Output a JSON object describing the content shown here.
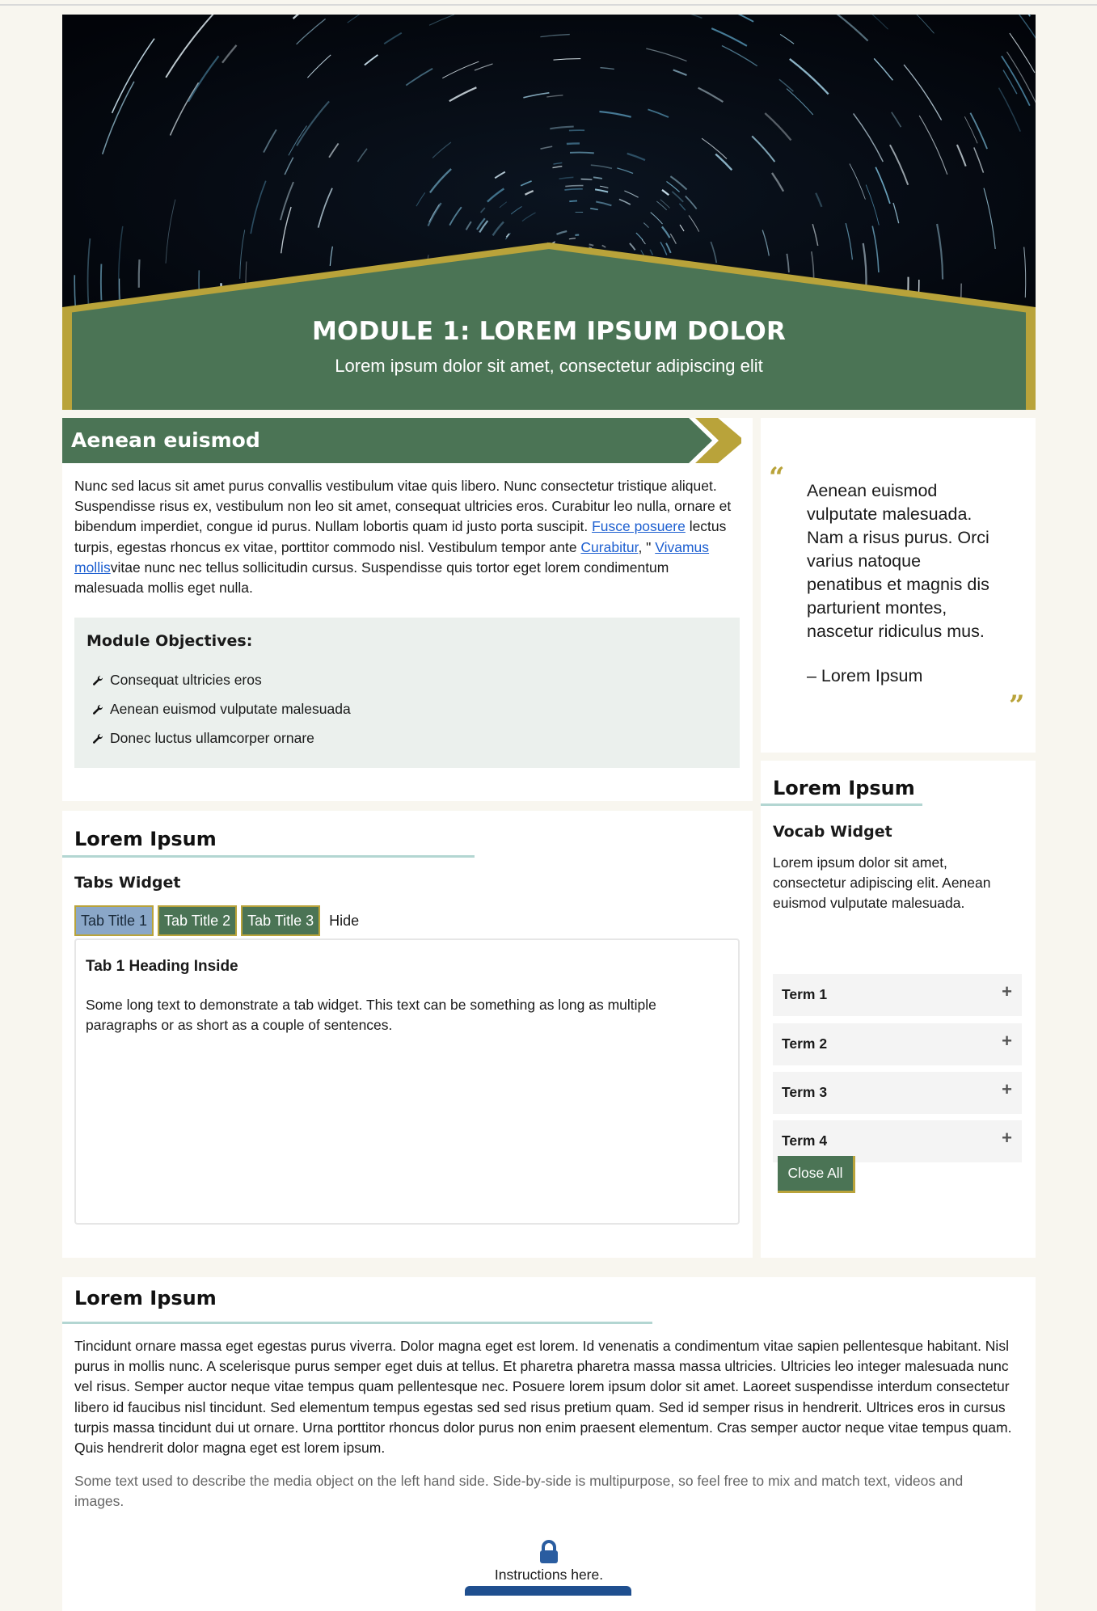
{
  "colors": {
    "green": "#4b7455",
    "gold": "#b9a33a",
    "teal_rule": "#b3d6d2",
    "link": "#1d5fd0",
    "panel_bg": "#ebf0ed"
  },
  "hero": {
    "title": "MODULE 1: LOREM IPSUM DOLOR",
    "subtitle": "Lorem ipsum dolor sit amet, consectetur adipiscing elit"
  },
  "intro_section": {
    "banner": "Aenean euismod",
    "p1": "Nunc sed lacus sit amet purus convallis vestibulum vitae quis libero. Nunc consectetur tristique aliquet. Suspendisse risus ex, vestibulum non leo sit amet, consequat ultricies eros. Curabitur leo nulla, ornare et bibendum imperdiet, congue id purus. Nullam lobortis quam id justo porta suscipit. ",
    "link1": "Fusce posuere",
    "p2": " lectus turpis, egestas rhoncus ex vitae, porttitor commodo nisl. Vestibulum tempor ante ",
    "link2": "Curabitur",
    "p3": ", \" ",
    "link3": "Vivamus mollis",
    "p4": "vitae nunc nec tellus sollicitudin cursus. Suspendisse quis tortor eget lorem condimentum malesuada mollis eget nulla.",
    "objectives_title": "Module Objectives:",
    "objectives": [
      "Consequat ultricies eros",
      "Aenean euismod vulputate malesuada",
      "Donec luctus ullamcorper ornare"
    ],
    "objective_icon": "wrench-icon"
  },
  "tabs_section": {
    "heading": "Lorem Ipsum",
    "widget_title": "Tabs Widget",
    "tabs": [
      "Tab Title 1",
      "Tab Title 2",
      "Tab Title 3"
    ],
    "active_tab": "Tab Title 1",
    "hide_label": "Hide",
    "panel_heading": "Tab 1 Heading Inside",
    "panel_text": "Some long text to demonstrate a tab widget. This text can be something as long as multiple paragraphs or as short as a couple of sentences."
  },
  "quote": {
    "open_mark": "“",
    "close_mark": "”",
    "text": "Aenean euismod vulputate malesuada. Nam a risus purus. Orci varius natoque penatibus et magnis dis parturient montes, nascetur ridiculus mus.",
    "cite": "– Lorem Ipsum"
  },
  "vocab_section": {
    "heading": "Lorem Ipsum",
    "widget_title": "Vocab Widget",
    "description": "Lorem ipsum dolor sit amet, consectetur adipiscing elit. Aenean euismod vulputate malesuada.",
    "terms": [
      "Term 1",
      "Term 2",
      "Term 3",
      "Term 4"
    ],
    "expand_symbol": "+",
    "close_all_label": "Close All"
  },
  "bottom_section": {
    "heading": "Lorem Ipsum",
    "paragraph": "Tincidunt ornare massa eget egestas purus viverra. Dolor magna eget est lorem. Id venenatis a condimentum vitae sapien pellentesque habitant. Nisl purus in mollis nunc. A scelerisque purus semper eget duis at tellus. Et pharetra pharetra massa massa ultricies. Ultricies leo integer malesuada nunc vel risus. Semper auctor neque vitae tempus quam pellentesque nec. Posuere lorem ipsum dolor sit amet. Laoreet suspendisse interdum consectetur libero id faucibus nisl tincidunt. Sed elementum tempus egestas sed sed risus pretium quam. Sed id semper risus in hendrerit. Ultrices eros in cursus turpis massa tincidunt dui ut ornare. Urna porttitor rhoncus dolor purus non enim praesent elementum. Cras semper auctor neque vitae tempus quam. Quis hendrerit dolor magna eget est lorem ipsum.",
    "media_caption": "Some text used to describe the media object on the left hand side. Side-by-side is multipurpose, so feel free to mix and match text, videos and images.",
    "instructions": "Instructions here.",
    "lock_icon": "lock-icon"
  }
}
